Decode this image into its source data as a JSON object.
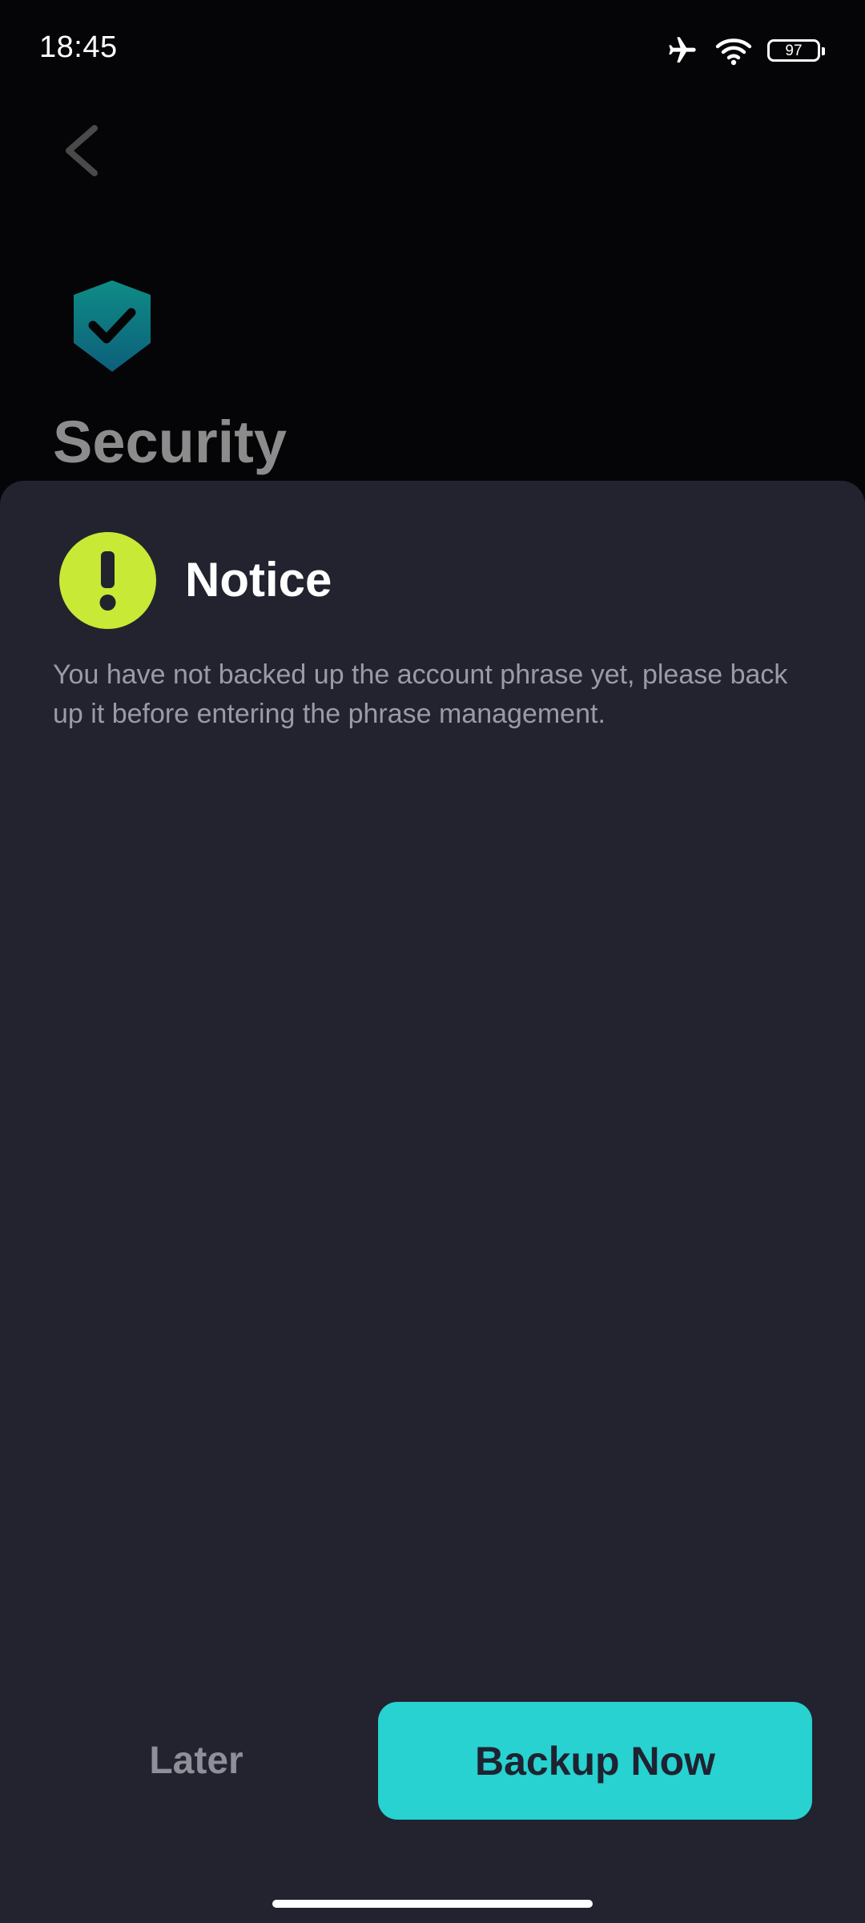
{
  "status_bar": {
    "time": "18:45",
    "battery_level": "97",
    "icons": [
      "airplane-mode-icon",
      "wifi-icon",
      "battery-icon"
    ]
  },
  "background_page": {
    "back_icon": "chevron-left-icon",
    "logo_icon": "shield-check-icon",
    "title": "Security"
  },
  "dialog": {
    "icon": "exclamation-icon",
    "title": "Notice",
    "message": "You have not backed up the account phrase yet, please back up it before entering the phrase management.",
    "secondary_button_label": "Later",
    "primary_button_label": "Backup Now"
  },
  "colors": {
    "accent": "#27d2d0",
    "warning": "#c8e935",
    "sheet_background": "#22232f",
    "page_background": "#050507"
  }
}
